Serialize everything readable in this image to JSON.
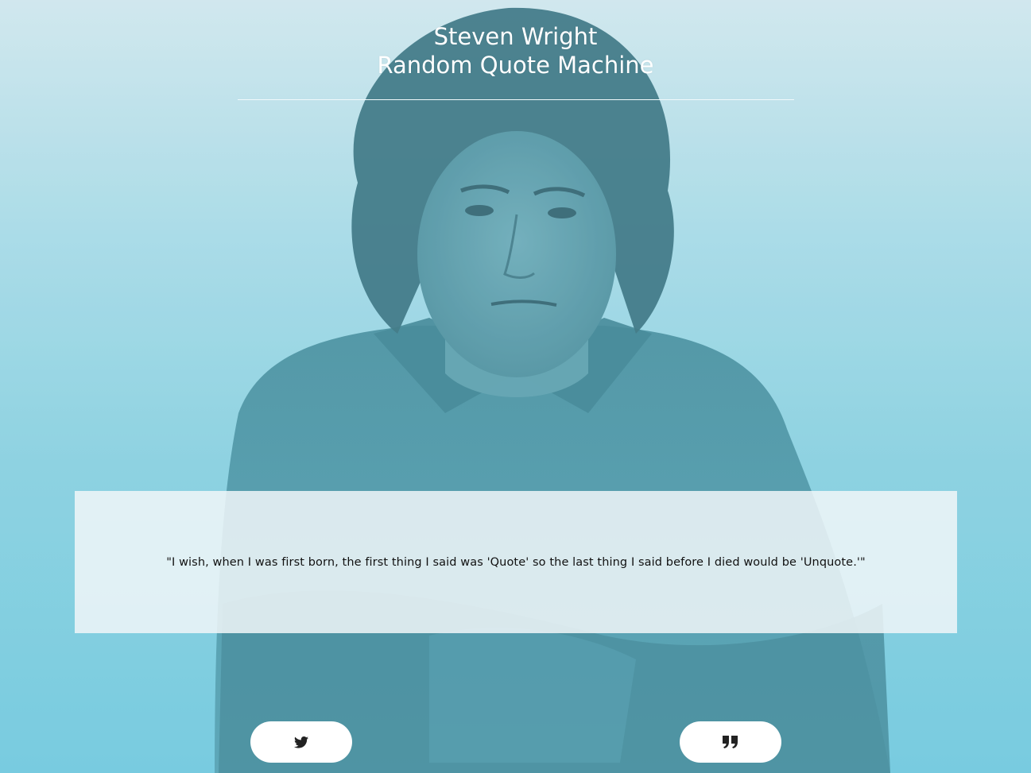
{
  "header": {
    "title_line1": "Steven Wright",
    "title_line2": "Random Quote Machine"
  },
  "quote": {
    "text": "\"I wish, when I was first born, the first thing I said was 'Quote' so the last thing I said before I died would be 'Unquote.'\""
  },
  "buttons": {
    "tweet": {
      "icon": "twitter-icon"
    },
    "new_quote": {
      "icon": "quote-icon"
    }
  },
  "colors": {
    "background_top": "#d4e8ee",
    "background_bottom": "#6fc8df",
    "portrait_tint": "#4f93a2",
    "quote_box": "#f0f6f8",
    "button_bg": "#ffffff",
    "icon_color": "#222222"
  }
}
